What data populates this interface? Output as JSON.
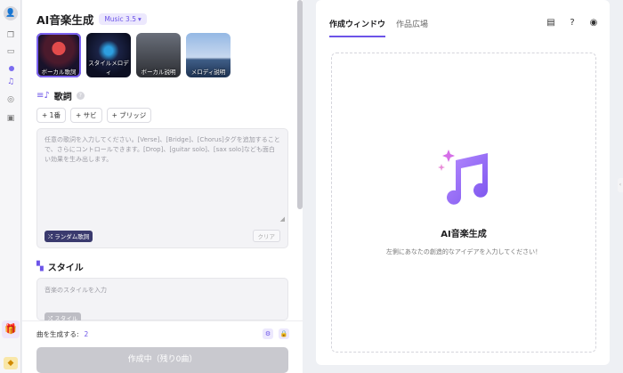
{
  "app": {
    "title": "AI音楽生成",
    "version_label": "Music 3.5"
  },
  "rail": {
    "icons": [
      "user-icon",
      "copy-icon",
      "folder-icon",
      "music-icon",
      "disc-icon",
      "box-icon",
      "gift-icon",
      "gem-icon"
    ],
    "avatar_glyph": "👤"
  },
  "cards": [
    {
      "label": "ボーカル歌詞",
      "selected": true
    },
    {
      "label": "スタイルメロディ",
      "selected": false
    },
    {
      "label": "ボーカル説明",
      "selected": false
    },
    {
      "label": "メロディ説明",
      "selected": false
    }
  ],
  "lyrics": {
    "section_label": "歌詞",
    "chips": [
      "+ 1番",
      "+ サビ",
      "+ ブリッジ"
    ],
    "placeholder": "任意の歌詞を入力してください。[Verse]、[Bridge]、[Chorus]タグを追加することで、さらにコントロールできます。[Drop]、[guitar solo]、[sax solo]なども面白い効果を生み出します。",
    "random_button": "ランダム歌詞",
    "clear_button": "クリア"
  },
  "style": {
    "section_label": "スタイル",
    "placeholder": "音楽のスタイルを入力",
    "style_button": "スタイル"
  },
  "footer": {
    "gen_label": "曲を生成する:",
    "gen_count": "2",
    "create_button": "作成中（残り0曲）"
  },
  "right": {
    "tabs": [
      {
        "label": "作成ウィンドウ",
        "active": true
      },
      {
        "label": "作品広場",
        "active": false
      }
    ],
    "empty_title": "AI音楽生成",
    "empty_subtitle": "左側にあなたの創造的なアイデアを入力してください！"
  },
  "colors": {
    "accent": "#6c54e8",
    "disabled": "#c9c9cf"
  }
}
